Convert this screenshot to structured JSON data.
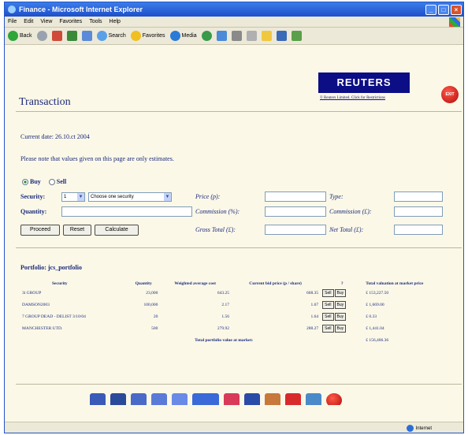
{
  "window": {
    "title": "Finance - Microsoft Internet Explorer"
  },
  "menu": [
    "File",
    "Edit",
    "View",
    "Favorites",
    "Tools",
    "Help"
  ],
  "toolbar": {
    "back": "Back",
    "search": "Search",
    "favorites": "Favorites",
    "media": "Media"
  },
  "brand": {
    "logo": "REUTERS",
    "link": "© Reuters Limited. Click for Restrictions",
    "exit": "EXIT"
  },
  "page": {
    "title": "Transaction",
    "current_date": "Current date: 26.10.ct 2004",
    "notice": "Please note that values given on this page are only estimates."
  },
  "form": {
    "buy": "Buy",
    "sell": "Sell",
    "security_label": "Security:",
    "security_index": "1",
    "security_select": "Choose one security",
    "quantity_label": "Quantity:",
    "price_label": "Price (p):",
    "commission_pct_label": "Commission (%):",
    "gross_total_label": "Gross Total (£):",
    "type_label": "Type:",
    "commission_gbp_label": "Commission (£):",
    "net_total_label": "Net Total (£):",
    "proceed": "Proceed",
    "reset": "Reset",
    "calculate": "Calculate"
  },
  "portfolio": {
    "title": "Portfolio: jcs_portfolio",
    "headers": [
      "Security",
      "Quantity",
      "Weighted average cost",
      "Current bid price (p / share)",
      "?",
      "Total valuation at market price"
    ],
    "rows": [
      {
        "security": "3i GROUP",
        "quantity": "23,000",
        "avg_cost": "643.25",
        "bid": "668.35",
        "valuation": "£ 153,227.50"
      },
      {
        "security": "DAMSON2003",
        "quantity": "100,000",
        "avg_cost": "2.17",
        "bid": "1.67",
        "valuation": "£ 1,669.00"
      },
      {
        "security": "7 GROUP DEAD - DELIST 3/10/04",
        "quantity": "20",
        "avg_cost": "1.56",
        "bid": "1.64",
        "valuation": "£ 0.33"
      },
      {
        "security": "MANCHESTER UTD.",
        "quantity": "500",
        "avg_cost": "279.92",
        "bid": "288.27",
        "valuation": "£ 1,441.04"
      }
    ],
    "sell_label": "Sell",
    "buy_label": "Buy",
    "total_label": "Total portfolio value at market:",
    "total_value": "£ 156,406.36"
  },
  "bottom_icons": [
    "book-search-icon",
    "magnifier-icon",
    "zoom-search-icon",
    "zoom-graph-icon",
    "chart-icon",
    "ticker-icon",
    "lightning-chart-icon",
    "percent-icon",
    "money-bag-icon",
    "exchange-arrows-icon",
    "calendar-icon",
    "exit-icon"
  ],
  "status": {
    "zone": "Internet"
  },
  "colors": {
    "text": "#1b2a7a",
    "reuters_bg": "#0c0e86",
    "background": "#fbf8e8",
    "exit": "#c81010"
  }
}
